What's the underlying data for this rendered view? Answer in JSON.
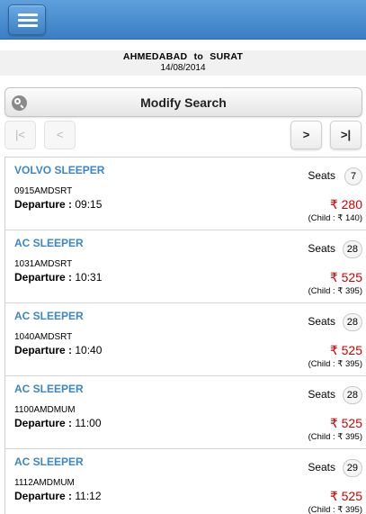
{
  "header": {
    "menu_icon": "hamburger-menu-icon"
  },
  "route": {
    "from": "AHMEDABAD",
    "to_word": "to",
    "to": "SURAT",
    "date": "14/08/2014"
  },
  "search": {
    "icon": "search-icon",
    "modify_label": "Modify Search"
  },
  "pager": {
    "first": "|<",
    "prev": "<",
    "next": ">",
    "last": ">|"
  },
  "currency_symbol": "₹",
  "seats_label": "Seats",
  "departure_label": "Departure :",
  "buses": [
    {
      "type": "VOLVO SLEEPER",
      "code": "0915AMDSRT",
      "departure": "09:15",
      "seats": "7",
      "fare": "₹ 280",
      "child_fare": "(Child : ₹ 140)"
    },
    {
      "type": "AC SLEEPER",
      "code": "1031AMDSRT",
      "departure": "10:31",
      "seats": "28",
      "fare": "₹ 525",
      "child_fare": "(Child : ₹ 395)"
    },
    {
      "type": "AC SLEEPER",
      "code": "1040AMDSRT",
      "departure": "10:40",
      "seats": "28",
      "fare": "₹ 525",
      "child_fare": "(Child : ₹ 395)"
    },
    {
      "type": "AC SLEEPER",
      "code": "1100AMDMUM",
      "departure": "11:00",
      "seats": "28",
      "fare": "₹ 525",
      "child_fare": "(Child : ₹ 395)"
    },
    {
      "type": "AC SLEEPER",
      "code": "1112AMDMUM",
      "departure": "11:12",
      "seats": "29",
      "fare": "₹ 525",
      "child_fare": "(Child : ₹ 395)"
    }
  ],
  "colors": {
    "header_blue": "#3a7fc4",
    "bus_type_blue": "#3b87c6",
    "fare_red": "#d30000"
  }
}
